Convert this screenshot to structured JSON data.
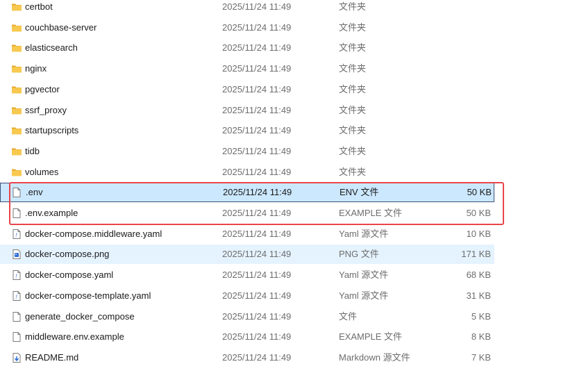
{
  "files": [
    {
      "name": "certbot",
      "date": "2025/11/24 11:49",
      "type": "文件夹",
      "size": "",
      "icon": "folder-icon"
    },
    {
      "name": "couchbase-server",
      "date": "2025/11/24 11:49",
      "type": "文件夹",
      "size": "",
      "icon": "folder-icon"
    },
    {
      "name": "elasticsearch",
      "date": "2025/11/24 11:49",
      "type": "文件夹",
      "size": "",
      "icon": "folder-icon"
    },
    {
      "name": "nginx",
      "date": "2025/11/24 11:49",
      "type": "文件夹",
      "size": "",
      "icon": "folder-icon"
    },
    {
      "name": "pgvector",
      "date": "2025/11/24 11:49",
      "type": "文件夹",
      "size": "",
      "icon": "folder-icon"
    },
    {
      "name": "ssrf_proxy",
      "date": "2025/11/24 11:49",
      "type": "文件夹",
      "size": "",
      "icon": "folder-icon"
    },
    {
      "name": "startupscripts",
      "date": "2025/11/24 11:49",
      "type": "文件夹",
      "size": "",
      "icon": "folder-icon"
    },
    {
      "name": "tidb",
      "date": "2025/11/24 11:49",
      "type": "文件夹",
      "size": "",
      "icon": "folder-icon"
    },
    {
      "name": "volumes",
      "date": "2025/11/24 11:49",
      "type": "文件夹",
      "size": "",
      "icon": "folder-icon"
    },
    {
      "name": ".env",
      "date": "2025/11/24 11:49",
      "type": "ENV 文件",
      "size": "50 KB",
      "icon": "file-icon",
      "state": "selected"
    },
    {
      "name": ".env.example",
      "date": "2025/11/24 11:49",
      "type": "EXAMPLE 文件",
      "size": "50 KB",
      "icon": "file-icon"
    },
    {
      "name": "docker-compose.middleware.yaml",
      "date": "2025/11/24 11:49",
      "type": "Yaml 源文件",
      "size": "10 KB",
      "icon": "yaml-file-icon"
    },
    {
      "name": "docker-compose.png",
      "date": "2025/11/24 11:49",
      "type": "PNG 文件",
      "size": "171 KB",
      "icon": "image-file-icon",
      "state": "hover"
    },
    {
      "name": "docker-compose.yaml",
      "date": "2025/11/24 11:49",
      "type": "Yaml 源文件",
      "size": "68 KB",
      "icon": "yaml-file-icon"
    },
    {
      "name": "docker-compose-template.yaml",
      "date": "2025/11/24 11:49",
      "type": "Yaml 源文件",
      "size": "31 KB",
      "icon": "yaml-file-icon"
    },
    {
      "name": "generate_docker_compose",
      "date": "2025/11/24 11:49",
      "type": "文件",
      "size": "5 KB",
      "icon": "file-icon"
    },
    {
      "name": "middleware.env.example",
      "date": "2025/11/24 11:49",
      "type": "EXAMPLE 文件",
      "size": "8 KB",
      "icon": "file-icon"
    },
    {
      "name": "README.md",
      "date": "2025/11/24 11:49",
      "type": "Markdown 源文件",
      "size": "7 KB",
      "icon": "markdown-file-icon"
    }
  ],
  "colors": {
    "folder": "#f8c950",
    "selection_bg": "#cce8ff",
    "hover_bg": "#e5f3ff",
    "annotation_border": "#e8454a"
  }
}
